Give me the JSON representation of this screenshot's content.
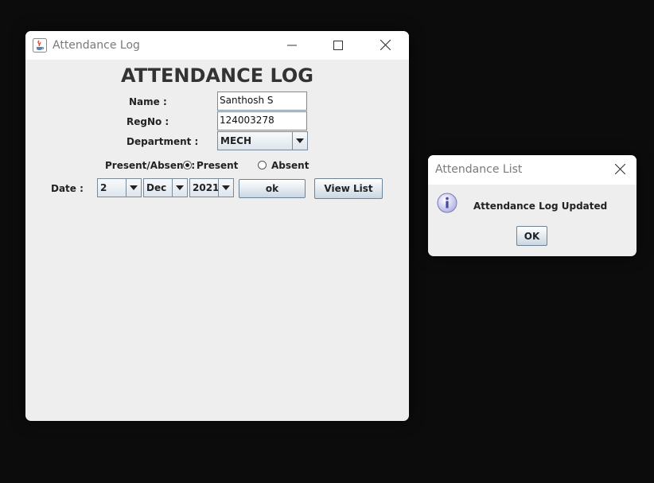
{
  "main_window": {
    "title": "Attendance Log",
    "heading": "ATTENDANCE LOG",
    "name_label": "Name :",
    "name_value": "Santhosh S",
    "regno_label": "RegNo :",
    "regno_value": "124003278",
    "department_label": "Department :",
    "department_value": "MECH",
    "status_label": "Present/Absent :",
    "present_label": "Present",
    "absent_label": "Absent",
    "selected_status": "Present",
    "date_label": "Date :",
    "day_value": "2",
    "month_value": "Dec",
    "year_value": "2021",
    "ok_label": "ok",
    "view_list_label": "View List"
  },
  "dialog": {
    "title": "Attendance List",
    "message": "Attendance Log Updated",
    "ok_label": "OK",
    "info_icon": "info-icon"
  },
  "colors": {
    "desktop": "#0c0c0c",
    "window_body": "#eeeeee",
    "titlebar": "#ffffff"
  }
}
